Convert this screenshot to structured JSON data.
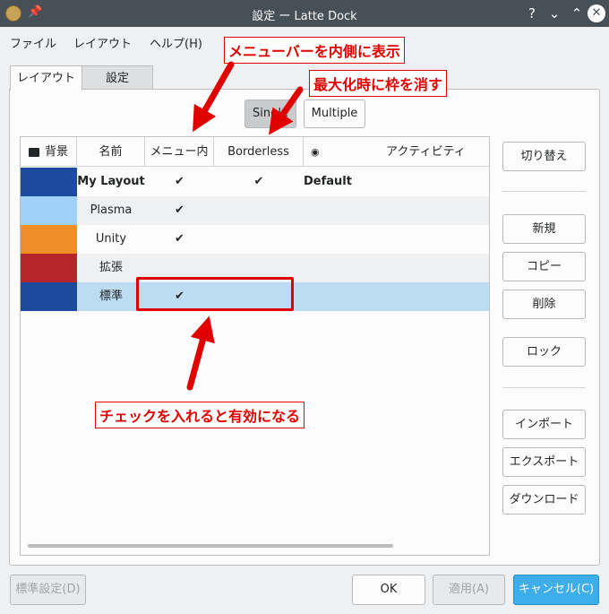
{
  "window": {
    "title": "設定 ー Latte Dock",
    "help": "?",
    "minimize": "⌄",
    "maximize": "⌃",
    "close": "✕"
  },
  "menubar": [
    "ファイル",
    "レイアウト",
    "ヘルプ(H)"
  ],
  "tabs": [
    "レイアウト",
    "設定"
  ],
  "mode_toggle": {
    "single": "Single",
    "multiple": "Multiple",
    "selected": "Single"
  },
  "table": {
    "headers": [
      "背景",
      "名前",
      "メニュー内",
      "Borderless",
      "アクティビティ"
    ],
    "rows": [
      {
        "name": "My Layout",
        "menu": "✔",
        "borderless": "✔",
        "activity": "Default",
        "bold": true,
        "swatch": "#1c4a9c"
      },
      {
        "name": "Plasma",
        "menu": "✔",
        "borderless": "",
        "activity": "",
        "bold": false,
        "swatch": "#9fd0f5"
      },
      {
        "name": "Unity",
        "menu": "✔",
        "borderless": "",
        "activity": "",
        "bold": false,
        "swatch": "#f08e2a"
      },
      {
        "name": "拡張",
        "menu": "",
        "borderless": "",
        "activity": "",
        "bold": false,
        "swatch": "#b5262b"
      },
      {
        "name": "標準",
        "menu": "✔",
        "borderless": "",
        "activity": "",
        "bold": false,
        "swatch": "#1c4a9c"
      }
    ],
    "selected_row": 4
  },
  "side_buttons": {
    "switch": "切り替え",
    "new": "新規",
    "copy": "コピー",
    "delete": "削除",
    "lock": "ロック",
    "import": "インポート",
    "export": "エクスポート",
    "download": "ダウンロード"
  },
  "footer": {
    "defaults": "標準設定(D)",
    "ok": "OK",
    "apply": "適用(A)",
    "cancel": "キャンセル(C)"
  },
  "annotations": {
    "menu_bar_inside": "メニューバーを内側に表示",
    "borderless": "最大化時に枠を消す",
    "check_enable": "チェックを入れると有効になる"
  },
  "colors": {
    "accent": "#3daee9",
    "annotation": "#e00000",
    "selection": "#bcdcf3"
  }
}
